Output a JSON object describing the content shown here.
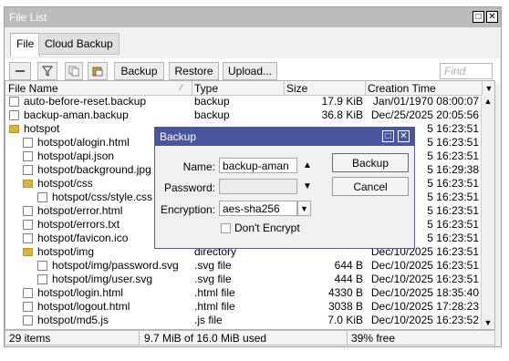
{
  "window": {
    "title": "File List"
  },
  "tabs": [
    {
      "label": "File"
    },
    {
      "label": "Cloud Backup"
    }
  ],
  "toolbar": {
    "backup": "Backup",
    "restore": "Restore",
    "upload": "Upload...",
    "find_placeholder": "Find"
  },
  "columns": {
    "name": "File Name",
    "type": "Type",
    "size": "Size",
    "created": "Creation Time"
  },
  "rows": [
    {
      "name": "auto-before-reset.backup",
      "type": "backup",
      "size": "17.9 KiB",
      "created": "Jan/01/1970 08:00:07",
      "icon": "file",
      "indent": 0
    },
    {
      "name": "backup-aman.backup",
      "type": "backup",
      "size": "36.8 KiB",
      "created": "Dec/25/2025 20:05:56",
      "icon": "file",
      "indent": 0
    },
    {
      "name": "hotspot",
      "type": "",
      "size": "",
      "created": "5 16:23:51",
      "icon": "folder",
      "indent": 0
    },
    {
      "name": "hotspot/alogin.html",
      "type": "",
      "size": "",
      "created": "5 16:23:51",
      "icon": "file",
      "indent": 1
    },
    {
      "name": "hotspot/api.json",
      "type": "",
      "size": "",
      "created": "5 16:23:51",
      "icon": "file",
      "indent": 1
    },
    {
      "name": "hotspot/background.jpg",
      "type": "",
      "size": "",
      "created": "5 16:29:38",
      "icon": "file",
      "indent": 1
    },
    {
      "name": "hotspot/css",
      "type": "",
      "size": "",
      "created": "5 16:23:51",
      "icon": "folder",
      "indent": 1
    },
    {
      "name": "hotspot/css/style.css",
      "type": "",
      "size": "",
      "created": "5 16:23:51",
      "icon": "file",
      "indent": 2
    },
    {
      "name": "hotspot/error.html",
      "type": "",
      "size": "",
      "created": "5 16:23:51",
      "icon": "file",
      "indent": 1
    },
    {
      "name": "hotspot/errors.txt",
      "type": "",
      "size": "",
      "created": "5 16:23:51",
      "icon": "file",
      "indent": 1
    },
    {
      "name": "hotspot/favicon.ico",
      "type": "",
      "size": "",
      "created": "5 16:23:51",
      "icon": "file",
      "indent": 1
    },
    {
      "name": "hotspot/img",
      "type": "directory",
      "size": "",
      "created": "Dec/10/2025 16:23:51",
      "icon": "folder",
      "indent": 1
    },
    {
      "name": "hotspot/img/password.svg",
      "type": ".svg file",
      "size": "644 B",
      "created": "Dec/10/2025 16:23:51",
      "icon": "file",
      "indent": 2
    },
    {
      "name": "hotspot/img/user.svg",
      "type": ".svg file",
      "size": "444 B",
      "created": "Dec/10/2025 16:23:51",
      "icon": "file",
      "indent": 2
    },
    {
      "name": "hotspot/login.html",
      "type": ".html file",
      "size": "4330 B",
      "created": "Dec/10/2025 18:35:40",
      "icon": "file",
      "indent": 1
    },
    {
      "name": "hotspot/logout.html",
      "type": ".html file",
      "size": "3038 B",
      "created": "Dec/10/2025 17:28:23",
      "icon": "file",
      "indent": 1
    },
    {
      "name": "hotspot/md5.js",
      "type": ".js file",
      "size": "7.0 KiB",
      "created": "Dec/10/2025 16:23:52",
      "icon": "file",
      "indent": 1
    }
  ],
  "status": {
    "items": "29 items",
    "usage": "9.7 MiB of 16.0 MiB used",
    "free": "39% free"
  },
  "dialog": {
    "title": "Backup",
    "name_label": "Name:",
    "name_value": "backup-aman",
    "password_label": "Password:",
    "password_value": "",
    "encryption_label": "Encryption:",
    "encryption_value": "aes-sha256",
    "dont_encrypt": "Don't Encrypt",
    "backup_button": "Backup",
    "cancel_button": "Cancel"
  }
}
